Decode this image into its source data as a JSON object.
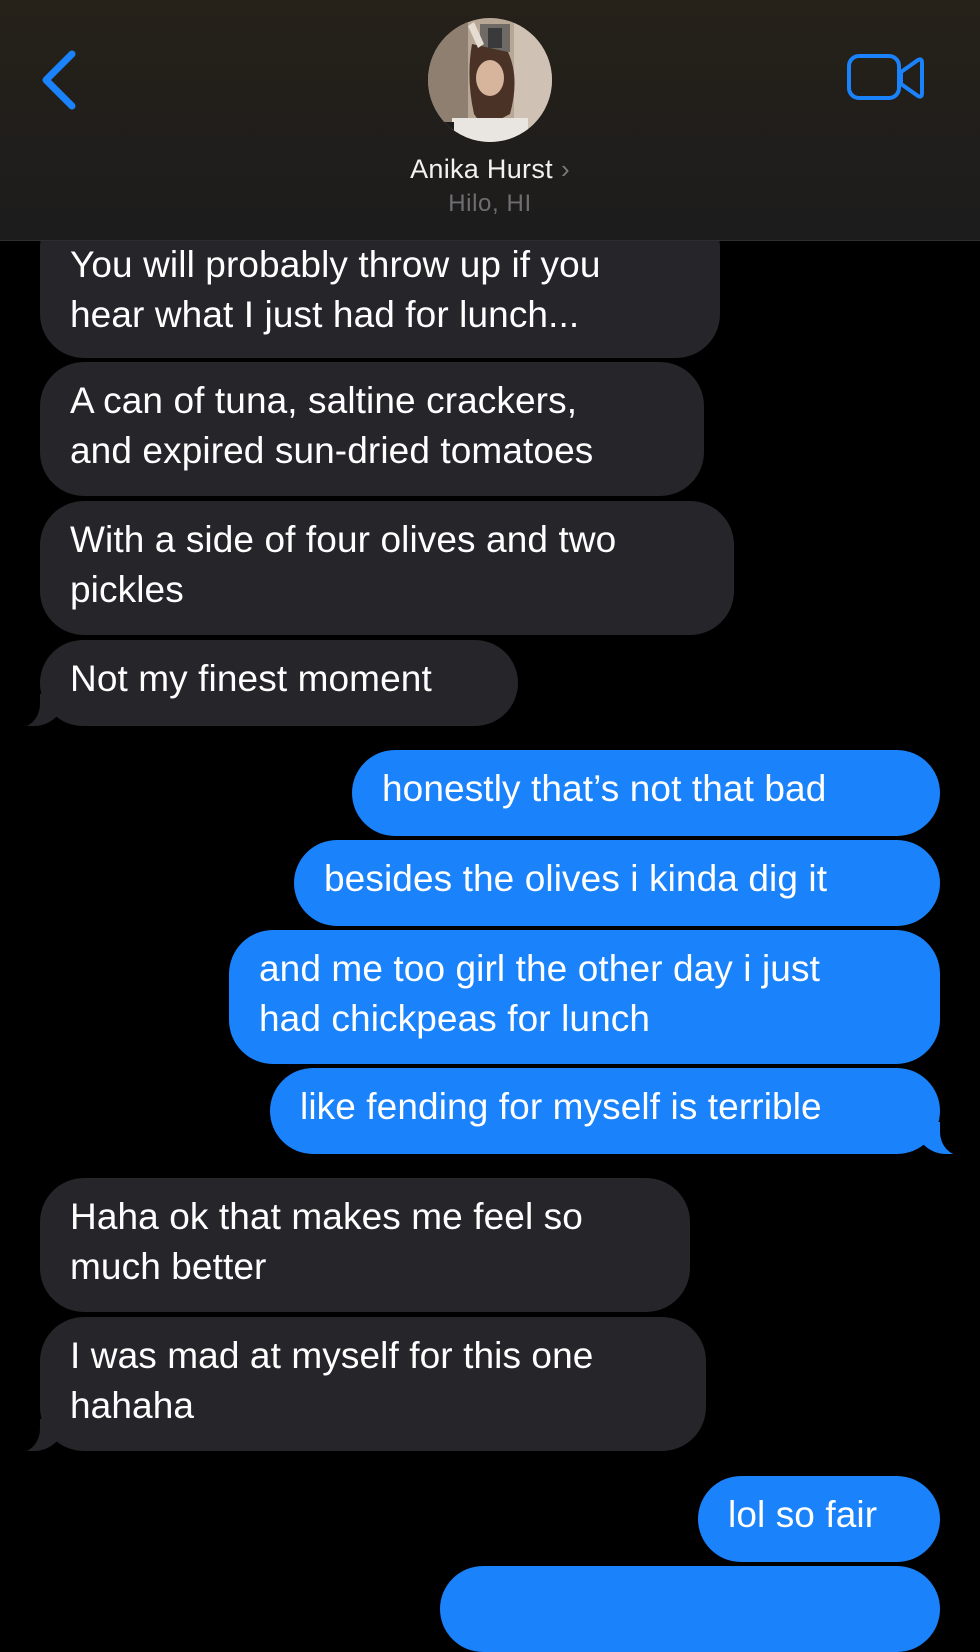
{
  "header": {
    "contact_name": "Anika Hurst",
    "contact_chevron": "›",
    "contact_location": "Hilo, HI",
    "back_icon": "chevron-left-icon",
    "video_icon": "video-camera-icon",
    "accent_color": "#1a82fb"
  },
  "messages": [
    {
      "direction": "incoming",
      "lines": [
        "You will probably throw up if you",
        "hear what I just had for lunch..."
      ]
    },
    {
      "direction": "incoming",
      "lines": [
        "A can of tuna, saltine crackers,",
        "and expired sun-dried tomatoes"
      ]
    },
    {
      "direction": "incoming",
      "lines": [
        "With a side of four olives and two",
        "pickles"
      ]
    },
    {
      "direction": "incoming",
      "lines": [
        "Not my finest moment"
      ]
    },
    {
      "direction": "outgoing",
      "lines": [
        "honestly that’s not that bad"
      ]
    },
    {
      "direction": "outgoing",
      "lines": [
        "besides the olives i kinda dig it"
      ]
    },
    {
      "direction": "outgoing",
      "lines": [
        "and me too girl the other day i just",
        "had chickpeas for lunch"
      ]
    },
    {
      "direction": "outgoing",
      "lines": [
        "like fending for myself is terrible"
      ]
    },
    {
      "direction": "incoming",
      "lines": [
        "Haha ok that makes me feel so",
        "much better"
      ]
    },
    {
      "direction": "incoming",
      "lines": [
        "I was mad at myself for this one",
        "hahaha"
      ]
    },
    {
      "direction": "outgoing",
      "lines": [
        "lol so fair"
      ]
    }
  ],
  "colors": {
    "incoming_bubble": "#26252a",
    "outgoing_bubble": "#1a82fb",
    "background": "#000000"
  }
}
